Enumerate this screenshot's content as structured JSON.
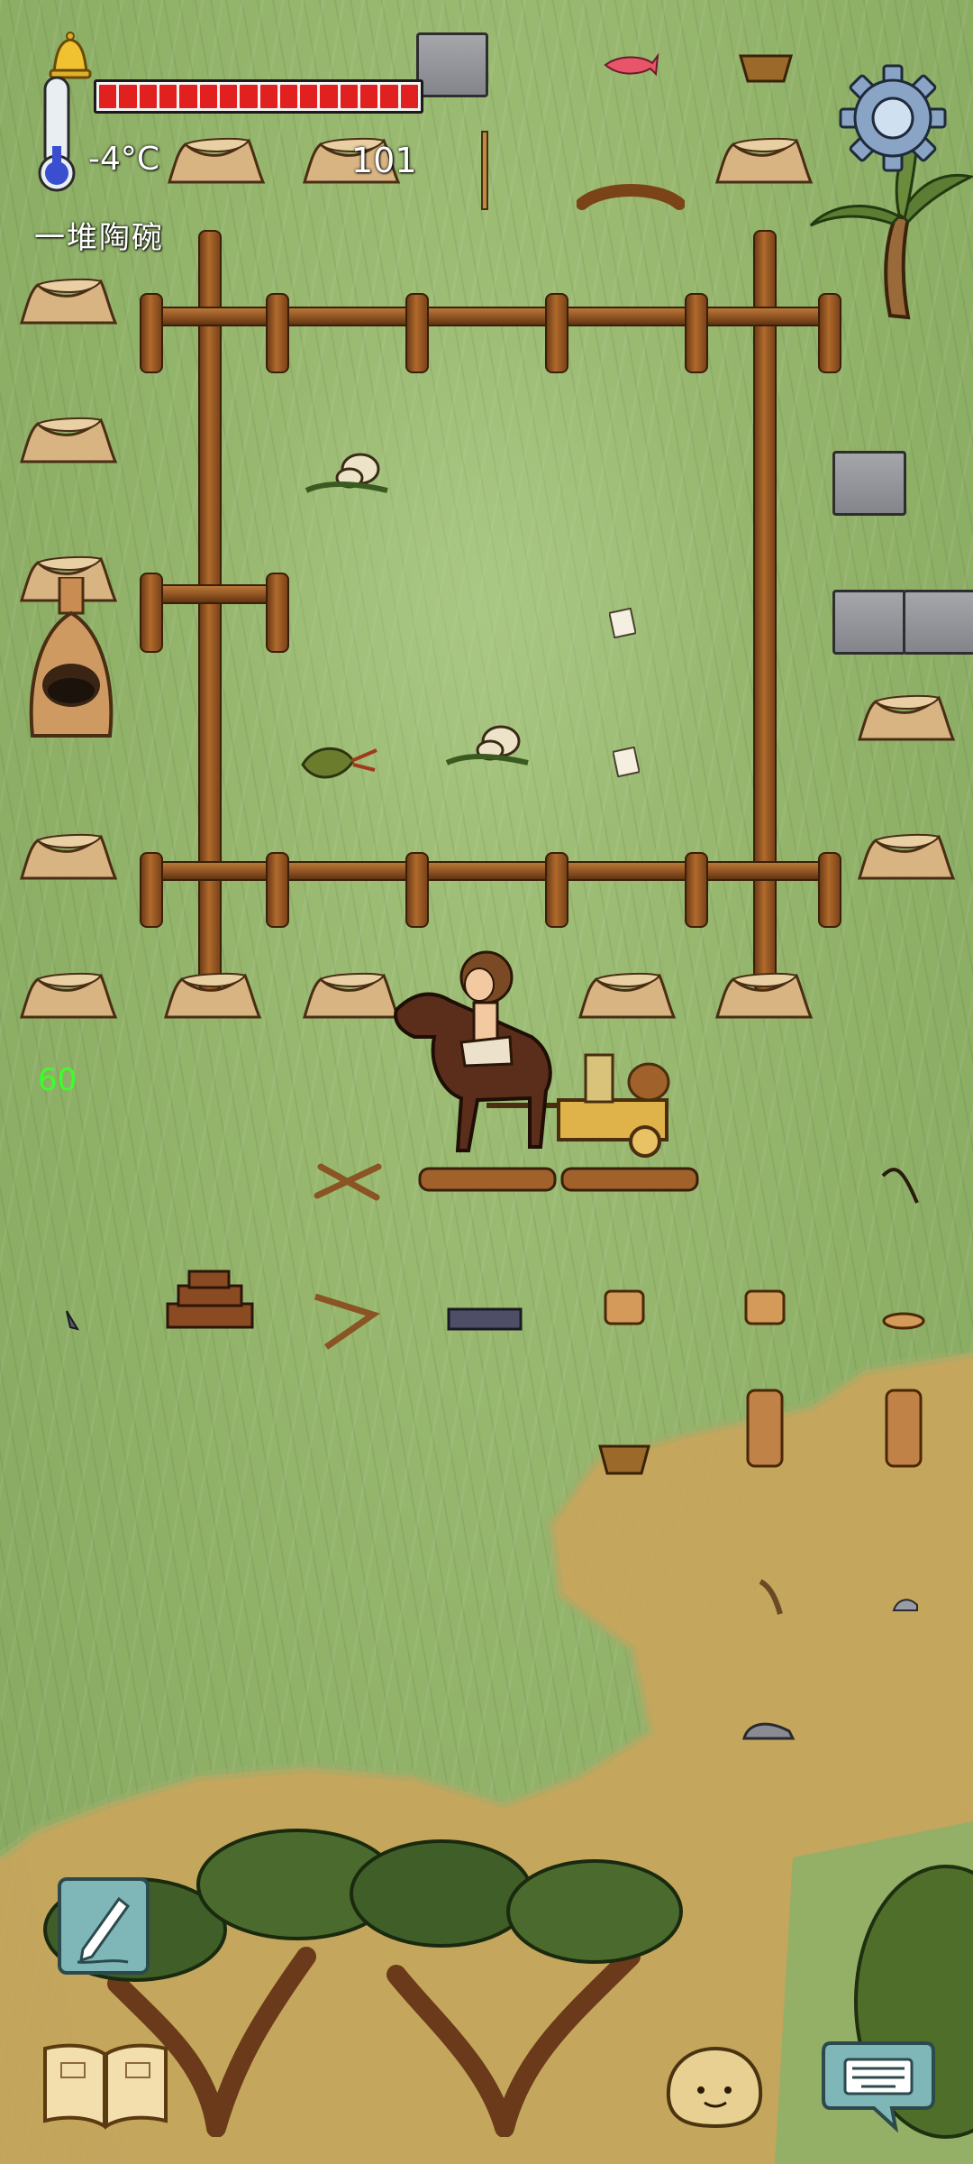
{
  "hud": {
    "temperature": "-4°C",
    "food_count": "101",
    "held_item": "一堆陶碗",
    "fps": "60",
    "health_segments": 16,
    "temperature_level": 0.3
  },
  "colors": {
    "health": "#e0211f",
    "fps_text": "#3cff2a",
    "grass": "#8fb067",
    "dirt": "#c9a55c",
    "fence": "#a0622a"
  },
  "controls": {
    "settings_icon": "gear-icon",
    "notes_icon": "pencil-icon",
    "tech_tree_icon": "book-icon",
    "emote_icon": "face-icon",
    "chat_icon": "keyboard-icon",
    "alert_icon": "bell-icon"
  }
}
